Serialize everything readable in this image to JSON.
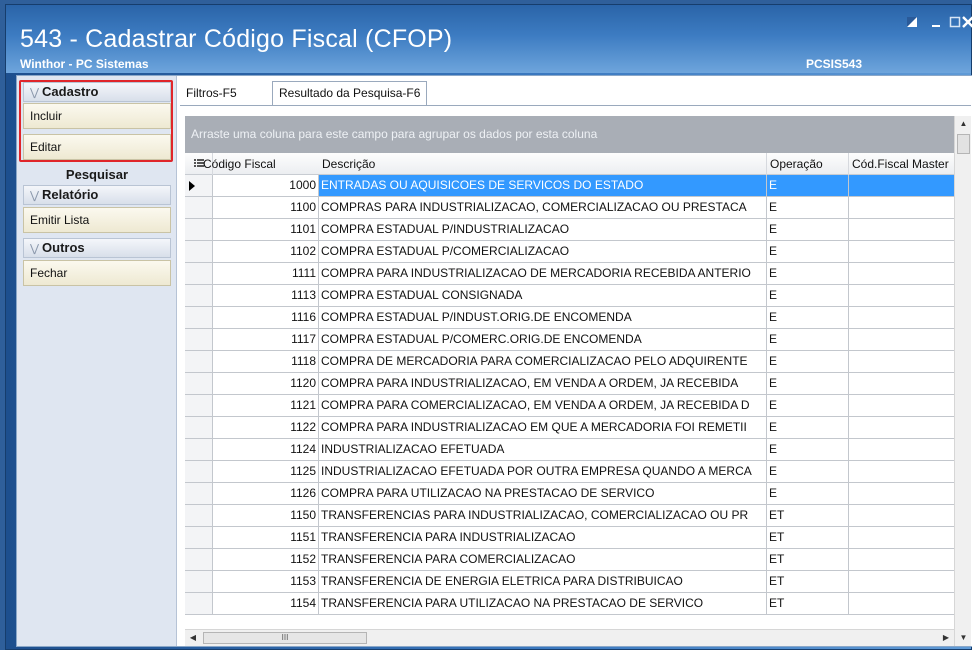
{
  "window": {
    "title": "543 - Cadastrar Código Fiscal (CFOP)",
    "subtitle": "Winthor - PC Sistemas",
    "code": "PCSIS543"
  },
  "sidebar": {
    "cadastro_header": "Cadastro",
    "incluir": "Incluir",
    "editar": "Editar",
    "pesquisar": "Pesquisar",
    "relatorio_header": "Relatório",
    "emitir_lista": "Emitir Lista",
    "outros_header": "Outros",
    "fechar": "Fechar"
  },
  "tabs": {
    "filtros": "Filtros-F5",
    "resultado": "Resultado da Pesquisa-F6"
  },
  "grid": {
    "group_hint": "Arraste uma coluna para este campo para agrupar os dados por esta coluna",
    "columns": {
      "codigo": "Código Fiscal",
      "descricao": "Descrição",
      "operacao": "Operação",
      "master": "Cód.Fiscal Master"
    },
    "rows": [
      {
        "codigo": "1000",
        "descricao": "ENTRADAS OU AQUISICOES DE SERVICOS DO ESTADO",
        "operacao": "E",
        "master": ""
      },
      {
        "codigo": "1100",
        "descricao": "COMPRAS PARA INDUSTRIALIZACAO, COMERCIALIZACAO OU PRESTACA",
        "operacao": "E",
        "master": ""
      },
      {
        "codigo": "1101",
        "descricao": "COMPRA ESTADUAL P/INDUSTRIALIZACAO",
        "operacao": "E",
        "master": ""
      },
      {
        "codigo": "1102",
        "descricao": "COMPRA ESTADUAL P/COMERCIALIZACAO",
        "operacao": "E",
        "master": ""
      },
      {
        "codigo": "1111",
        "descricao": "COMPRA PARA INDUSTRIALIZACAO DE MERCADORIA RECEBIDA ANTERIO",
        "operacao": "E",
        "master": ""
      },
      {
        "codigo": "1113",
        "descricao": "COMPRA ESTADUAL CONSIGNADA",
        "operacao": "E",
        "master": ""
      },
      {
        "codigo": "1116",
        "descricao": "COMPRA ESTADUAL P/INDUST.ORIG.DE ENCOMENDA",
        "operacao": "E",
        "master": ""
      },
      {
        "codigo": "1117",
        "descricao": "COMPRA ESTADUAL P/COMERC.ORIG.DE ENCOMENDA",
        "operacao": "E",
        "master": ""
      },
      {
        "codigo": "1118",
        "descricao": "COMPRA DE MERCADORIA PARA COMERCIALIZACAO PELO ADQUIRENTE",
        "operacao": "E",
        "master": ""
      },
      {
        "codigo": "1120",
        "descricao": "COMPRA PARA INDUSTRIALIZACAO, EM VENDA A ORDEM, JA RECEBIDA",
        "operacao": "E",
        "master": ""
      },
      {
        "codigo": "1121",
        "descricao": "COMPRA PARA COMERCIALIZACAO, EM VENDA A ORDEM, JA RECEBIDA D",
        "operacao": "E",
        "master": ""
      },
      {
        "codigo": "1122",
        "descricao": "COMPRA PARA INDUSTRIALIZACAO EM QUE A MERCADORIA FOI REMETII",
        "operacao": "E",
        "master": ""
      },
      {
        "codigo": "1124",
        "descricao": "INDUSTRIALIZACAO EFETUADA",
        "operacao": "E",
        "master": ""
      },
      {
        "codigo": "1125",
        "descricao": "INDUSTRIALIZACAO EFETUADA POR OUTRA EMPRESA QUANDO A MERCA",
        "operacao": "E",
        "master": ""
      },
      {
        "codigo": "1126",
        "descricao": "COMPRA PARA UTILIZACAO NA PRESTACAO DE SERVICO",
        "operacao": "E",
        "master": ""
      },
      {
        "codigo": "1150",
        "descricao": "TRANSFERENCIAS PARA INDUSTRIALIZACAO, COMERCIALIZACAO OU PR",
        "operacao": "ET",
        "master": ""
      },
      {
        "codigo": "1151",
        "descricao": "TRANSFERENCIA PARA INDUSTRIALIZACAO",
        "operacao": "ET",
        "master": ""
      },
      {
        "codigo": "1152",
        "descricao": "TRANSFERENCIA PARA COMERCIALIZACAO",
        "operacao": "ET",
        "master": ""
      },
      {
        "codigo": "1153",
        "descricao": "TRANSFERENCIA DE ENERGIA ELETRICA PARA DISTRIBUICAO",
        "operacao": "ET",
        "master": ""
      },
      {
        "codigo": "1154",
        "descricao": "TRANSFERENCIA PARA UTILIZACAO NA PRESTACAO DE SERVICO",
        "operacao": "ET",
        "master": ""
      }
    ],
    "selected_row_index": 0,
    "selection_color": "#3399ff",
    "scroll_thumb_glyph": "III"
  },
  "colors": {
    "highlight_box": "#e0252a",
    "title_bg": "#3d7cc2"
  }
}
